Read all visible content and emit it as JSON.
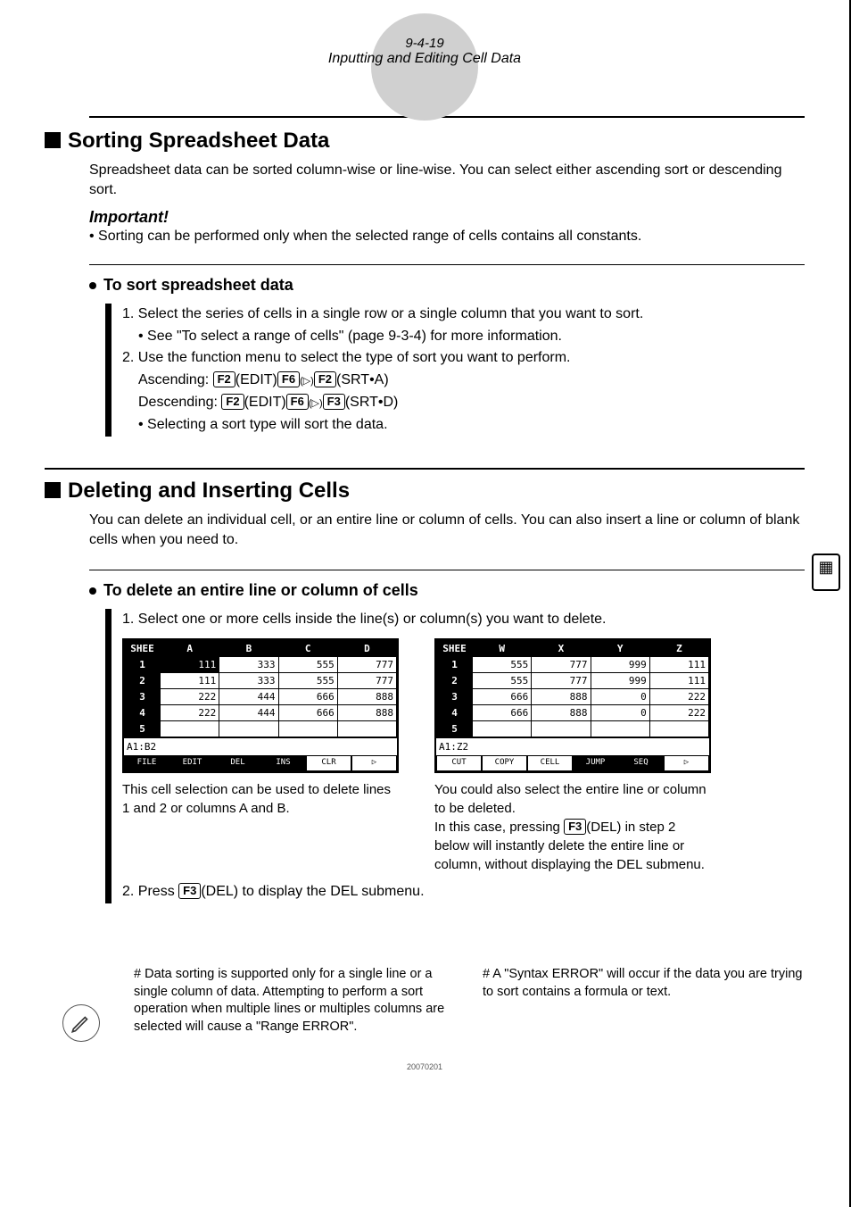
{
  "header": {
    "page_num": "9-4-19",
    "title": "Inputting and Editing Cell Data"
  },
  "section1": {
    "heading": "Sorting Spreadsheet Data",
    "intro": "Spreadsheet data can be sorted column-wise or line-wise. You can select either ascending sort or descending sort.",
    "important_label": "Important!",
    "important_text": "• Sorting can be performed only when the selected range of cells contains all constants."
  },
  "section1_sub": {
    "heading": "To sort spreadsheet data",
    "step1": "1. Select the series of cells in a single row or a single column that you want to sort.",
    "step1_note": "• See \"To select a range of cells\" (page 9-3-4) for more information.",
    "step2": "2. Use the function menu to select the type of sort you want to perform.",
    "asc_label": "Ascending: ",
    "asc_seq": [
      "F2",
      "(EDIT)",
      "F6",
      "(▷)",
      "F2",
      "(SRT•A)"
    ],
    "desc_label": "Descending: ",
    "desc_seq": [
      "F2",
      "(EDIT)",
      "F6",
      "(▷)",
      "F3",
      "(SRT•D)"
    ],
    "step2_note": "• Selecting a sort type will sort the data."
  },
  "section2": {
    "heading": "Deleting and Inserting Cells",
    "intro": "You can delete an individual cell, or an entire line or column of cells. You can also insert a line or column of blank cells when you need to."
  },
  "section2_sub": {
    "heading": "To delete an entire line or column of cells",
    "step1": "1. Select one or more cells inside the line(s) or column(s) you want to delete.",
    "left_caption": "This cell selection can be used to delete lines 1 and 2 or columns A and B.",
    "right_caption_1": "You could also select the entire line or column to be deleted.",
    "right_caption_2a": "In this case, pressing ",
    "right_caption_2_key": "F3",
    "right_caption_2b": "(DEL) in step 2 below will instantly delete the entire line or column, without displaying the DEL submenu.",
    "step2a": "2. Press ",
    "step2_key": "F3",
    "step2b": "(DEL) to display the DEL submenu."
  },
  "screen_left": {
    "corner": "SHEE",
    "cols": [
      "A",
      "B",
      "C",
      "D"
    ],
    "rows": [
      [
        "111",
        "333",
        "555",
        "777"
      ],
      [
        "111",
        "333",
        "555",
        "777"
      ],
      [
        "222",
        "444",
        "666",
        "888"
      ],
      [
        "222",
        "444",
        "666",
        "888"
      ],
      [
        "",
        "",
        "",
        ""
      ]
    ],
    "status": "A1:B2",
    "menu": [
      "FILE",
      "EDIT",
      "DEL",
      "INS",
      "CLR",
      "▷"
    ]
  },
  "screen_right": {
    "corner": "SHEE",
    "cols": [
      "W",
      "X",
      "Y",
      "Z"
    ],
    "rows": [
      [
        "555",
        "777",
        "999",
        "111"
      ],
      [
        "555",
        "777",
        "999",
        "111"
      ],
      [
        "666",
        "888",
        "0",
        "222"
      ],
      [
        "666",
        "888",
        "0",
        "222"
      ],
      [
        "",
        "",
        "",
        ""
      ]
    ],
    "status": "A1:Z2",
    "menu": [
      "CUT",
      "COPY",
      "CELL",
      "JUMP",
      "SEQ",
      "▷"
    ]
  },
  "footnotes": {
    "left": "# Data sorting is supported only for a single line or a single column of data. Attempting to perform a sort operation when multiple lines or multiples columns are selected will cause a \"Range ERROR\".",
    "right": "# A \"Syntax ERROR\" will occur if the data you are trying to sort contains a formula or text."
  },
  "footer": {
    "code": "20070201"
  }
}
